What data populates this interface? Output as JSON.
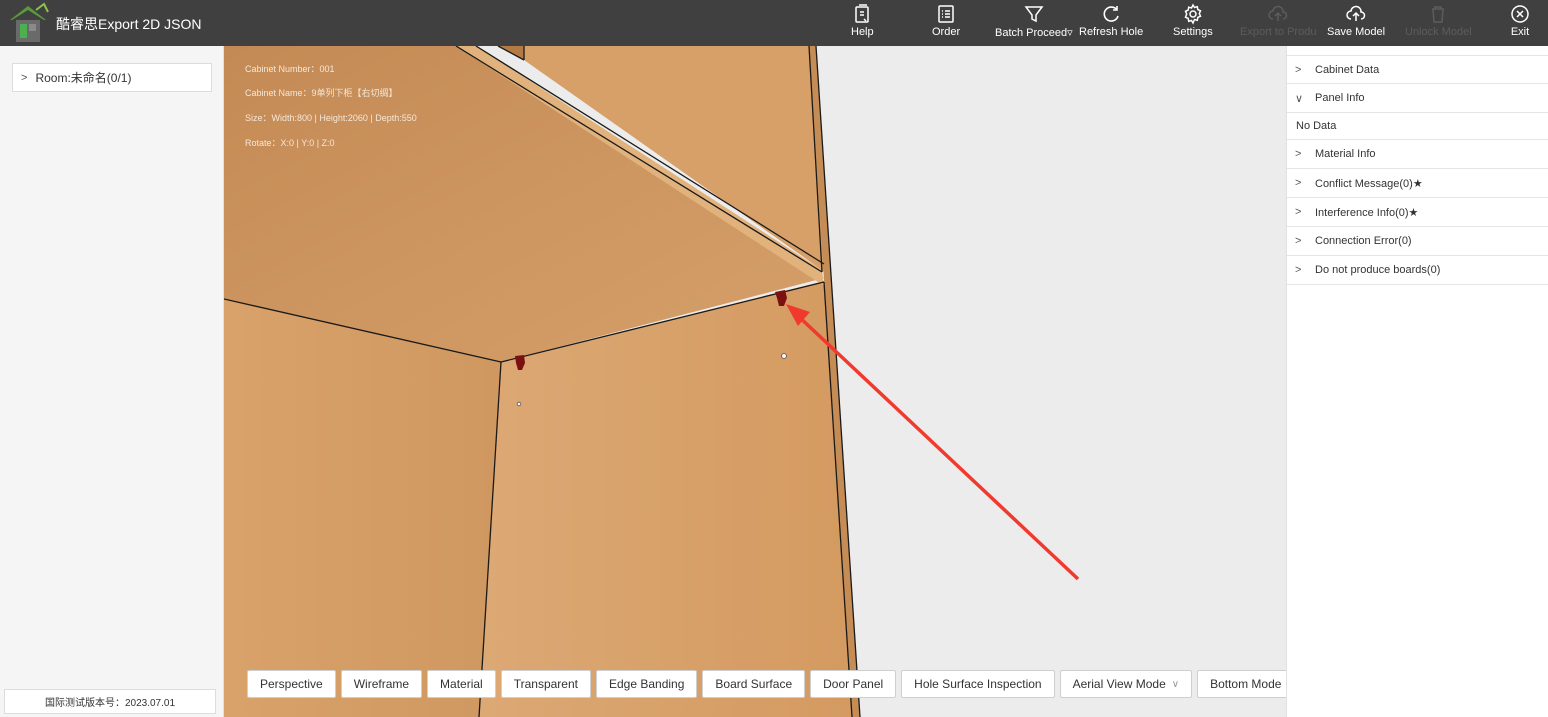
{
  "app": {
    "title": "酷睿思Export 2D JSON"
  },
  "toolbar": [
    {
      "key": "help",
      "label": "Help",
      "icon": "help-doc-icon",
      "disabled": false
    },
    {
      "key": "order",
      "label": "Order",
      "icon": "order-list-icon",
      "disabled": false
    },
    {
      "key": "batch",
      "label": "Batch Proceed▿",
      "icon": "funnel-icon",
      "disabled": false
    },
    {
      "key": "refresh",
      "label": "Refresh Hole",
      "icon": "refresh-icon",
      "disabled": false
    },
    {
      "key": "settings",
      "label": "Settings",
      "icon": "gear-icon",
      "disabled": false
    },
    {
      "key": "export",
      "label": "Export to Produ",
      "icon": "cloud-upload-icon",
      "disabled": true
    },
    {
      "key": "save",
      "label": "Save Model",
      "icon": "cloud-upload-icon",
      "disabled": false
    },
    {
      "key": "unlock",
      "label": "Unlock Model",
      "icon": "trash-icon",
      "disabled": true
    },
    {
      "key": "exit",
      "label": "Exit",
      "icon": "close-circle-icon",
      "disabled": false
    }
  ],
  "left": {
    "room_label": "Room:未命名(0/1)",
    "version": "国际测试版本号：2023.07.01"
  },
  "cabinet_info": {
    "number": "Cabinet Number：001",
    "name": "Cabinet Name：9单列下柜【右切绸】",
    "size": "Size：Width:800 | Height:2060 | Depth:550",
    "rotate": "Rotate：X:0 | Y:0 | Z:0"
  },
  "view_buttons": [
    {
      "label": "Perspective",
      "dropdown": false
    },
    {
      "label": "Wireframe",
      "dropdown": false
    },
    {
      "label": "Material",
      "dropdown": false
    },
    {
      "label": "Transparent",
      "dropdown": false
    },
    {
      "label": "Edge Banding",
      "dropdown": false
    },
    {
      "label": "Board Surface",
      "dropdown": false
    },
    {
      "label": "Door Panel",
      "dropdown": false
    },
    {
      "label": "Hole Surface Inspection",
      "dropdown": false
    },
    {
      "label": "Aerial View Mode",
      "dropdown": true
    },
    {
      "label": "Bottom Mode",
      "dropdown": true
    }
  ],
  "right_panel": {
    "sections": [
      {
        "label": "Cabinet Data",
        "expanded": false
      },
      {
        "label": "Panel Info",
        "expanded": true,
        "content": "No Data"
      },
      {
        "label": "Material Info",
        "expanded": false
      },
      {
        "label": "Conflict Message(0)★",
        "expanded": false
      },
      {
        "label": "Interference Info(0)★",
        "expanded": false
      },
      {
        "label": "Connection Error(0)",
        "expanded": false
      },
      {
        "label": "Do not produce boards(0)",
        "expanded": false
      }
    ]
  },
  "colors": {
    "topbar": "#404040",
    "wood_light": "#d9a46a",
    "wood_dark": "#c98f55",
    "annotation_arrow": "#f03a2e",
    "connector": "#7a1010"
  }
}
